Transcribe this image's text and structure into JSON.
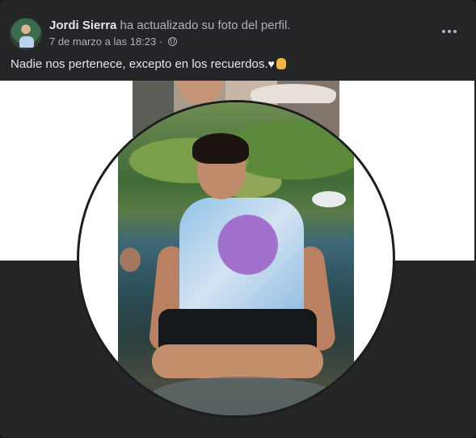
{
  "post": {
    "author": "Jordi Sierra",
    "action": "ha actualizado su foto del perfil.",
    "date": "7 de marzo a las 18:23",
    "separator": "·",
    "caption": "Nadie nos pertenece, excepto en los recuerdos.",
    "caption_emojis": [
      "white-heart",
      "hand"
    ]
  },
  "icons": {
    "privacy": "globe-icon",
    "more": "more-horizontal-icon"
  },
  "colors": {
    "card_bg": "#242526",
    "primary_text": "#e4e6eb",
    "secondary_text": "#b0b3b8"
  }
}
